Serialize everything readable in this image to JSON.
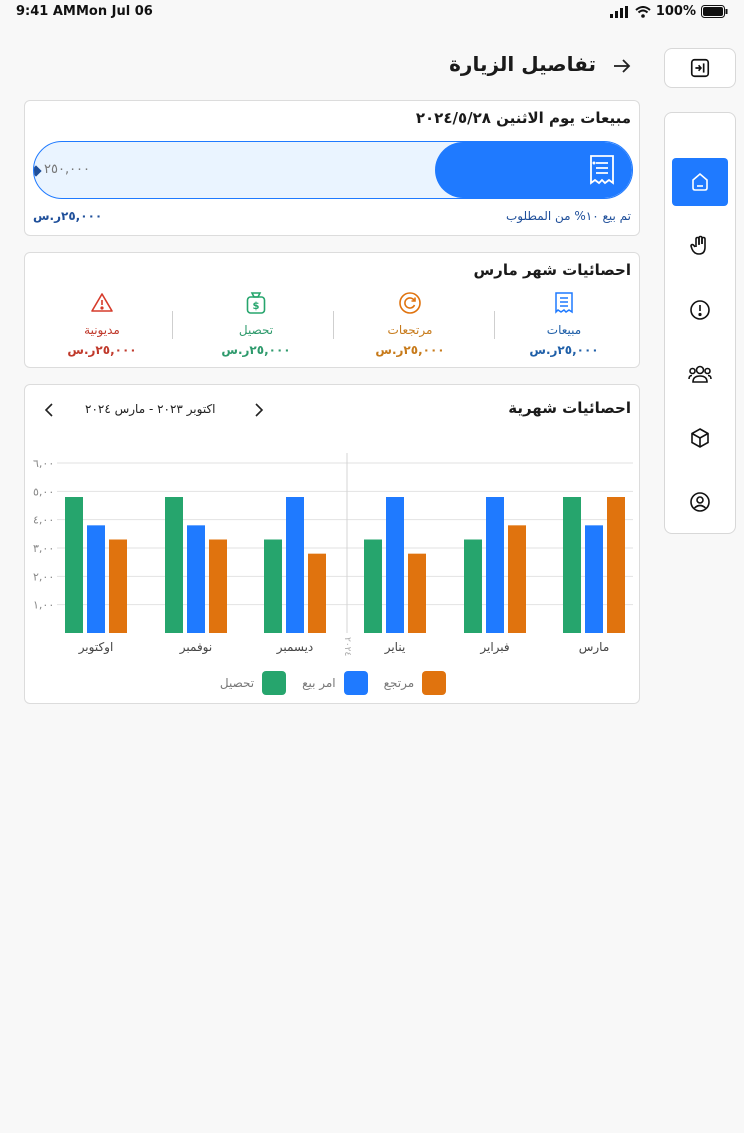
{
  "status": {
    "time": "9:41 AM",
    "date": "Mon Jul 06",
    "battery": "100%"
  },
  "header": {
    "title": "تفاصيل الزيارة"
  },
  "sidebar": {
    "items": [
      {
        "icon": "home-icon",
        "active": true
      },
      {
        "icon": "hand-icon",
        "active": false
      },
      {
        "icon": "alert-icon",
        "active": false
      },
      {
        "icon": "users-icon",
        "active": false
      },
      {
        "icon": "box-icon",
        "active": false
      },
      {
        "icon": "profile-icon",
        "active": false
      }
    ]
  },
  "sales_card": {
    "title": "مبيعات يوم الاثنين ٢٠٢٤/٥/٢٨",
    "target": "٢٥٠,٠٠٠",
    "progress": 0.33,
    "progress_text": "تم بيع ١٠% من المطلوب",
    "amount": "٢٥,٠٠٠ر.س"
  },
  "march_stats": {
    "title": "احصائيات شهر مارس",
    "items": [
      {
        "label": "مبيعات",
        "value": "٢٥,٠٠٠ر.س",
        "color": "#1f5fa8",
        "icon": "receipt-icon"
      },
      {
        "label": "مرتجعات",
        "value": "٢٥,٠٠٠ر.س",
        "color": "#c77a1a",
        "icon": "refresh-icon"
      },
      {
        "label": "تحصيل",
        "value": "٢٥,٠٠٠ر.س",
        "color": "#2e9a6c",
        "icon": "money-bag-icon"
      },
      {
        "label": "مديونية",
        "value": "٢٥,٠٠٠ر.س",
        "color": "#c0392b",
        "icon": "warning-icon"
      }
    ]
  },
  "monthly": {
    "title": "احصائيات شهرية",
    "range": "اكتوبر ٢٠٢٣ - مارس ٢٠٢٤",
    "year_marker": "٢٠٢٤"
  },
  "colors": {
    "green": "#26a56d",
    "blue": "#1f7aff",
    "orange": "#e0730e"
  },
  "chart_data": {
    "type": "bar",
    "categories": [
      "اوكتوبر",
      "نوفمبر",
      "ديسمبر",
      "يناير",
      "فبراير",
      "مارس"
    ],
    "series": [
      {
        "name": "تحصيل",
        "values": [
          4.8,
          4.8,
          3.3,
          3.3,
          3.3,
          4.8
        ]
      },
      {
        "name": "امر بيع",
        "values": [
          3.8,
          3.8,
          4.8,
          4.8,
          4.8,
          3.8
        ]
      },
      {
        "name": "مرتجع",
        "values": [
          3.3,
          3.3,
          2.8,
          2.8,
          3.8,
          4.8
        ]
      }
    ],
    "yticks": [
      "١,٠٠",
      "٢,٠٠",
      "٣,٠٠",
      "٤,٠٠",
      "٥,٠٠",
      "٦,٠٠"
    ],
    "ylim": [
      0,
      6
    ],
    "grid": true,
    "legend": "bottom"
  }
}
